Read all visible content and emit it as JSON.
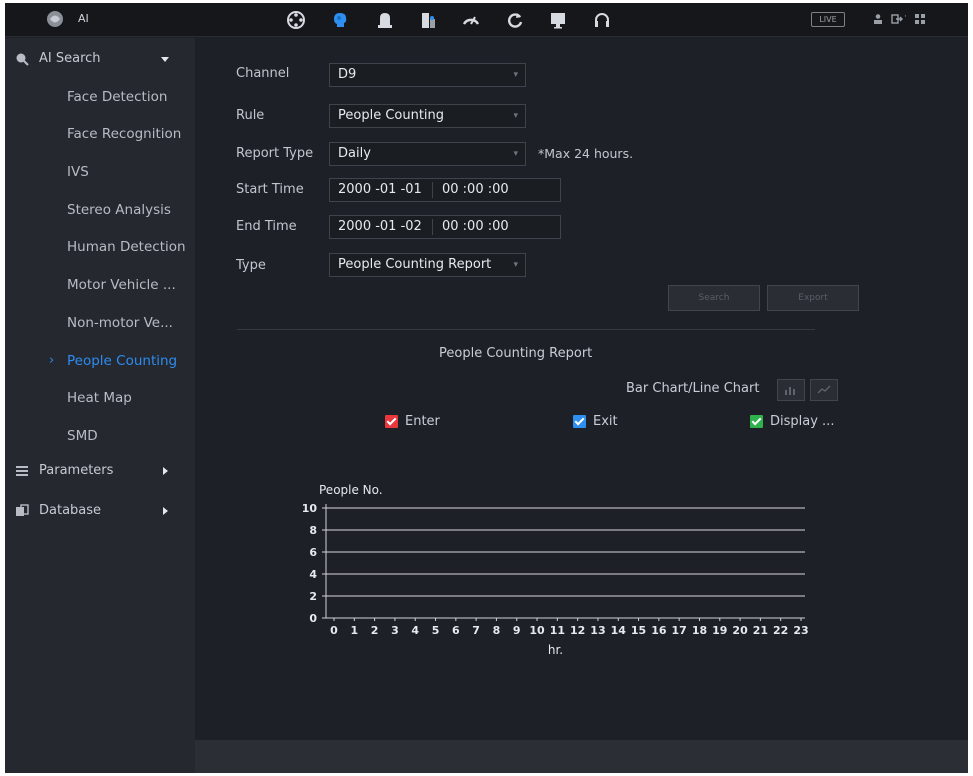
{
  "app": {
    "title": "AI"
  },
  "topbar": {
    "icons": [
      "playback-icon",
      "ai-icon",
      "alarm-icon",
      "search-icon",
      "operation-icon",
      "backup-icon",
      "display-icon",
      "support-icon"
    ],
    "live_label": "LIVE",
    "right_icons": [
      "account-icon",
      "logout-icon",
      "menu-icon"
    ]
  },
  "sidebar": {
    "ai_search_label": "AI Search",
    "items": [
      {
        "label": "Face Detection"
      },
      {
        "label": "Face Recognition"
      },
      {
        "label": "IVS"
      },
      {
        "label": "Stereo Analysis"
      },
      {
        "label": "Human Detection"
      },
      {
        "label": "Motor Vehicle ..."
      },
      {
        "label": "Non-motor Ve..."
      },
      {
        "label": "People Counting",
        "active": true
      },
      {
        "label": "Heat Map"
      },
      {
        "label": "SMD"
      }
    ],
    "parameters_label": "Parameters",
    "database_label": "Database"
  },
  "form": {
    "channel_label": "Channel",
    "channel_value": "D9",
    "rule_label": "Rule",
    "rule_value": "People Counting",
    "report_type_label": "Report Type",
    "report_type_value": "Daily",
    "report_hint": "*Max 24 hours.",
    "start_label": "Start Time",
    "start_date": "2000 -01 -01",
    "start_time": "00 :00 :00",
    "end_label": "End Time",
    "end_date": "2000 -01 -02",
    "end_time": "00 :00 :00",
    "type_label": "Type",
    "type_value": "People Counting Report"
  },
  "buttons": {
    "search_label": "Search",
    "export_label": "Export"
  },
  "report": {
    "title": "People Counting Report",
    "chart_toggle_label": "Bar Chart/Line Chart",
    "legend": [
      {
        "label": "Enter",
        "color": "#e8383d"
      },
      {
        "label": "Exit",
        "color": "#2e8ff0"
      },
      {
        "label": "Display ...",
        "color": "#2fb14c"
      }
    ]
  },
  "chart_data": {
    "type": "line",
    "ylabel": "People No.",
    "xlabel": "hr.",
    "ylim": [
      0,
      10
    ],
    "y_ticks": [
      0,
      2,
      4,
      6,
      8,
      10
    ],
    "x": [
      0,
      1,
      2,
      3,
      4,
      5,
      6,
      7,
      8,
      9,
      10,
      11,
      12,
      13,
      14,
      15,
      16,
      17,
      18,
      19,
      20,
      21,
      22,
      23
    ],
    "series": [],
    "grid": true
  }
}
